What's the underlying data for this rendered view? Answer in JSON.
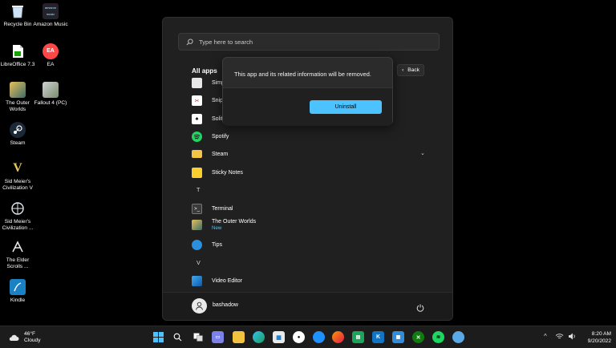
{
  "desktop": {
    "icons": [
      {
        "label": "Recycle Bin",
        "icon": "recycle-bin-icon"
      },
      {
        "label": "Amazon Music",
        "icon": "amazon-music-icon",
        "badge": "amazon music"
      },
      {
        "label": "LibreOffice 7.3",
        "icon": "libreoffice-icon"
      },
      {
        "label": "EA",
        "icon": "ea-icon",
        "badge": "EA"
      },
      {
        "label": "The Outer Worlds",
        "icon": "outer-worlds-icon"
      },
      {
        "label": "Fallout 4 (PC)",
        "icon": "fallout-icon"
      },
      {
        "label": "Steam",
        "icon": "steam-icon"
      },
      {
        "label": "Sid Meier's Civilization V",
        "icon": "civilization-v-icon",
        "badge": "V"
      },
      {
        "label": "Sid Meier's Civilization ...",
        "icon": "civilization-icon"
      },
      {
        "label": "The Elder Scrolls ...",
        "icon": "elder-scrolls-icon"
      },
      {
        "label": "Kindle",
        "icon": "kindle-icon"
      }
    ]
  },
  "start_menu": {
    "search_placeholder": "Type here to search",
    "all_apps_title": "All apps",
    "back_label": "Back",
    "apps": [
      {
        "label": "Simp",
        "icon": "simplenote-icon"
      },
      {
        "label": "Snip",
        "icon": "snipping-tool-icon"
      },
      {
        "label": "Solit",
        "icon": "solitaire-icon"
      },
      {
        "label": "Spotify",
        "icon": "spotify-icon"
      },
      {
        "label": "Steam",
        "icon": "folder-icon"
      },
      {
        "label": "Sticky Notes",
        "icon": "sticky-notes-icon"
      },
      {
        "label": "Terminal",
        "icon": "terminal-icon"
      },
      {
        "label": "The Outer Worlds",
        "sub": "New",
        "icon": "outer-worlds-icon"
      },
      {
        "label": "Tips",
        "icon": "tips-icon"
      },
      {
        "label": "Video Editor",
        "icon": "video-editor-icon"
      }
    ],
    "letters": [
      "T",
      "V"
    ],
    "user_name": "bashadow"
  },
  "dialog": {
    "message": "This app and its related information will be removed.",
    "button_label": "Uninstall"
  },
  "taskbar": {
    "weather_temp": "46°F",
    "weather_desc": "Cloudy",
    "time": "8:20 AM",
    "date": "9/20/2022"
  },
  "colors": {
    "accent": "#4cc2ff",
    "start_bg": "#202020",
    "taskbar_bg": "#1c1c1c"
  }
}
